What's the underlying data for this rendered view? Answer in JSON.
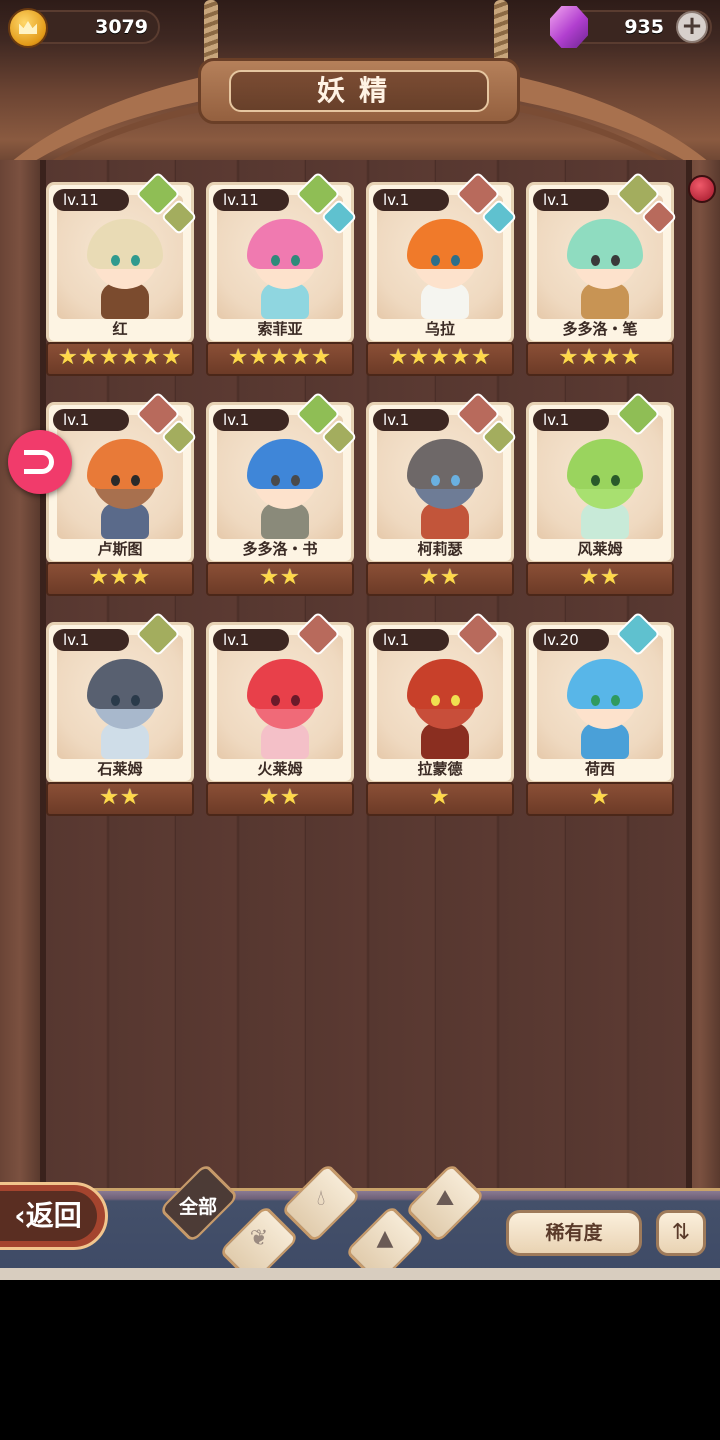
{
  "header": {
    "title": "妖精",
    "gold": "3079",
    "gems": "935",
    "add_label": "+"
  },
  "fairies": [
    {
      "level": "lv.11",
      "name": "红",
      "stars": "★★★★★★",
      "elements": [
        "grass",
        "earth"
      ],
      "hair": "#e9dbb5",
      "skin": "#fde2cc",
      "body": "#7b4b2e",
      "eye": "#2f9a8e"
    },
    {
      "level": "lv.11",
      "name": "索菲亚",
      "stars": "★★★★★",
      "elements": [
        "grass",
        "water"
      ],
      "hair": "#f07ab0",
      "skin": "#fde2cc",
      "body": "#8fd6e0",
      "eye": "#2f8a7a"
    },
    {
      "level": "lv.1",
      "name": "乌拉",
      "stars": "★★★★★",
      "elements": [
        "fire",
        "water"
      ],
      "hair": "#f07a2a",
      "skin": "#fde2cc",
      "body": "#f5f5f0",
      "eye": "#2c6f8a"
    },
    {
      "level": "lv.1",
      "name": "多多洛・笔",
      "stars": "★★★★",
      "elements": [
        "earth",
        "fire"
      ],
      "hair": "#8fdcc0",
      "skin": "#fde2cc",
      "body": "#c89454",
      "eye": "#3a3a3a"
    },
    {
      "level": "lv.1",
      "name": "卢斯图",
      "stars": "★★★",
      "elements": [
        "fire",
        "earth"
      ],
      "hair": "#e87a38",
      "skin": "#a8704e",
      "body": "#5a6a8a",
      "eye": "#2a2a2a"
    },
    {
      "level": "lv.1",
      "name": "多多洛・书",
      "stars": "★★",
      "elements": [
        "grass",
        "earth"
      ],
      "hair": "#3f86d8",
      "skin": "#fde2cc",
      "body": "#8a8a7a",
      "eye": "#4a4a4a"
    },
    {
      "level": "lv.1",
      "name": "柯莉瑟",
      "stars": "★★",
      "elements": [
        "fire",
        "earth"
      ],
      "hair": "#6e6868",
      "skin": "#6e7c96",
      "body": "#c2553a",
      "eye": "#6ab0e0"
    },
    {
      "level": "lv.1",
      "name": "风莱姆",
      "stars": "★★",
      "elements": [
        "grass"
      ],
      "hair": "#9ad45e",
      "skin": "#a8e070",
      "body": "#c8ead8",
      "eye": "#2a5a2a"
    },
    {
      "level": "lv.1",
      "name": "石莱姆",
      "stars": "★★",
      "elements": [
        "earth"
      ],
      "hair": "#586070",
      "skin": "#a8b8cc",
      "body": "#cfdde8",
      "eye": "#2a3a4a"
    },
    {
      "level": "lv.1",
      "name": "火莱姆",
      "stars": "★★",
      "elements": [
        "fire"
      ],
      "hair": "#e8404a",
      "skin": "#f06a78",
      "body": "#f4c0c8",
      "eye": "#6a1a2a"
    },
    {
      "level": "lv.1",
      "name": "拉蒙德",
      "stars": "★",
      "elements": [
        "fire"
      ],
      "hair": "#c8402a",
      "skin": "#c84e3a",
      "body": "#8a2e20",
      "eye": "#f0e050"
    },
    {
      "level": "lv.20",
      "name": "荷西",
      "stars": "★",
      "elements": [
        "water"
      ],
      "hair": "#58b6e8",
      "skin": "#fde2cc",
      "body": "#4aa0d8",
      "eye": "#2f9a5e"
    }
  ],
  "bottom": {
    "back_label": "返回",
    "filter_all_label": "全部",
    "rarity_label": "稀有度",
    "sort_icon": "sort-icon"
  }
}
